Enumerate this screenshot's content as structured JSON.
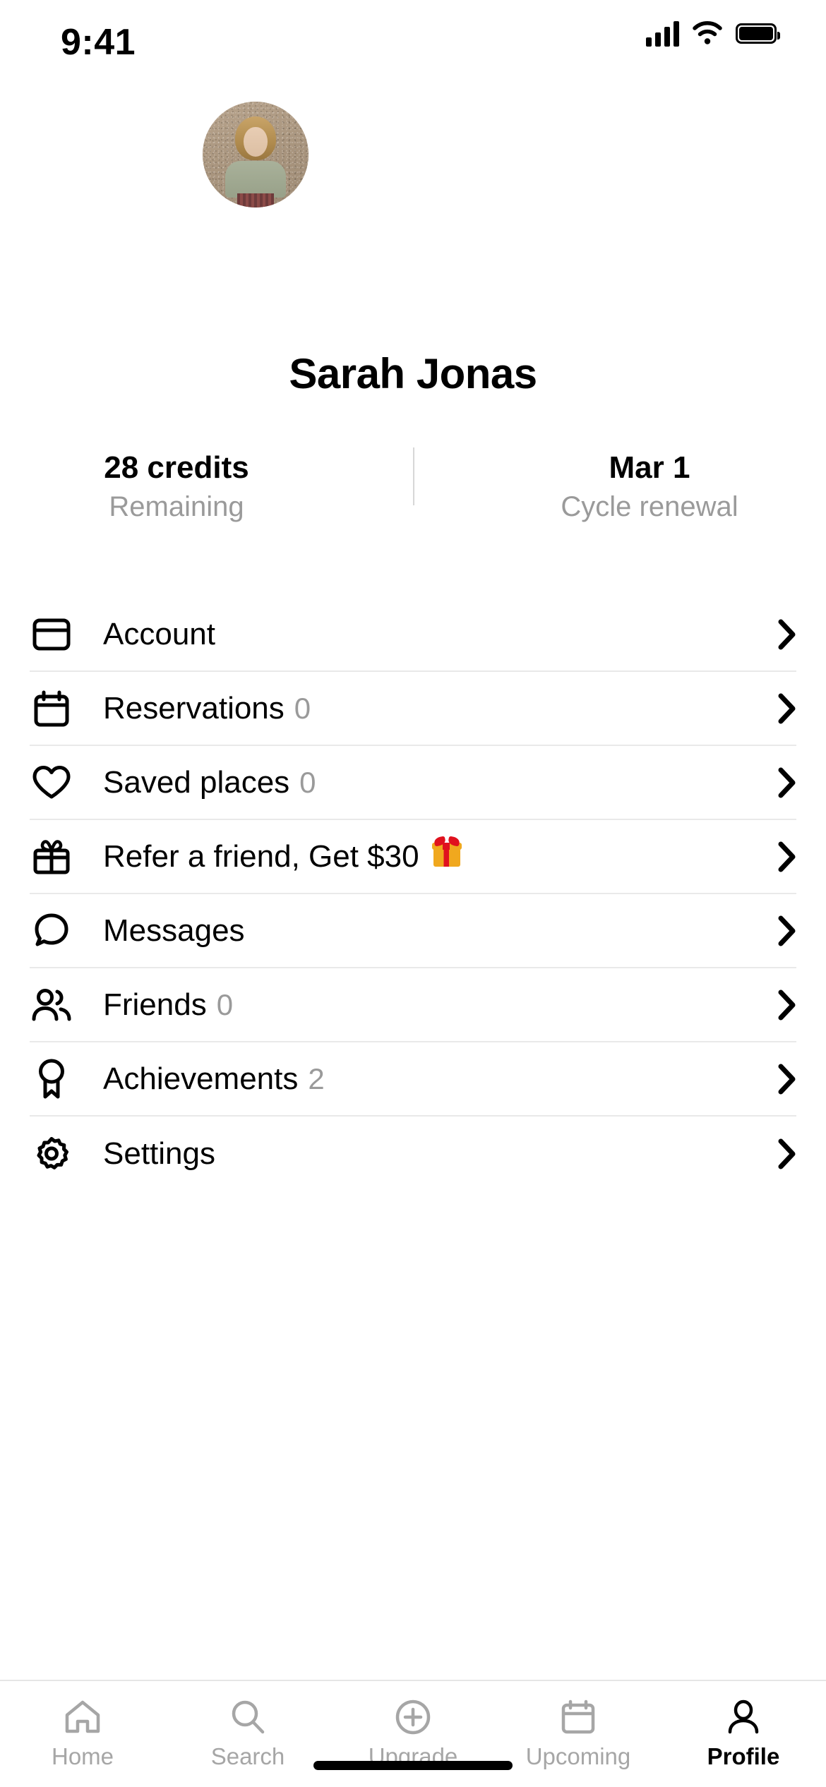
{
  "status_bar": {
    "time": "9:41",
    "signal_icon": "cellular-signal-icon",
    "wifi_icon": "wifi-icon",
    "battery_icon": "battery-icon"
  },
  "profile": {
    "avatar_name": "user-avatar",
    "name": "Sarah Jonas",
    "stats": [
      {
        "value": "28 credits",
        "label": "Remaining"
      },
      {
        "value": "Mar 1",
        "label": "Cycle renewal"
      }
    ]
  },
  "menu": {
    "items": [
      {
        "id": "account",
        "icon": "credit-card-icon",
        "label": "Account",
        "count": "",
        "emoji": ""
      },
      {
        "id": "reservations",
        "icon": "calendar-icon",
        "label": "Reservations",
        "count": "0",
        "emoji": ""
      },
      {
        "id": "saved-places",
        "icon": "heart-icon",
        "label": "Saved places",
        "count": "0",
        "emoji": ""
      },
      {
        "id": "refer",
        "icon": "gift-icon",
        "label": "Refer a friend, Get $30",
        "count": "",
        "emoji": "gift-emoji"
      },
      {
        "id": "messages",
        "icon": "chat-bubble-icon",
        "label": "Messages",
        "count": "",
        "emoji": ""
      },
      {
        "id": "friends",
        "icon": "people-icon",
        "label": "Friends",
        "count": "0",
        "emoji": ""
      },
      {
        "id": "achievements",
        "icon": "award-icon",
        "label": "Achievements",
        "count": "2",
        "emoji": ""
      },
      {
        "id": "settings",
        "icon": "gear-icon",
        "label": "Settings",
        "count": "",
        "emoji": ""
      }
    ],
    "chevron_icon": "chevron-right-icon"
  },
  "tabbar": {
    "tabs": [
      {
        "id": "home",
        "icon": "house-icon",
        "label": "Home",
        "active": false
      },
      {
        "id": "search",
        "icon": "magnifier-icon",
        "label": "Search",
        "active": false
      },
      {
        "id": "upgrade",
        "icon": "plus-circle-icon",
        "label": "Upgrade",
        "active": false
      },
      {
        "id": "upcoming",
        "icon": "calendar-icon",
        "label": "Upcoming",
        "active": false
      },
      {
        "id": "profile",
        "icon": "person-icon",
        "label": "Profile",
        "active": true
      }
    ]
  },
  "colors": {
    "text_primary": "#000000",
    "text_muted": "#9a9a9a",
    "tab_inactive": "#a6a6a6",
    "divider": "#e9e9e9"
  }
}
